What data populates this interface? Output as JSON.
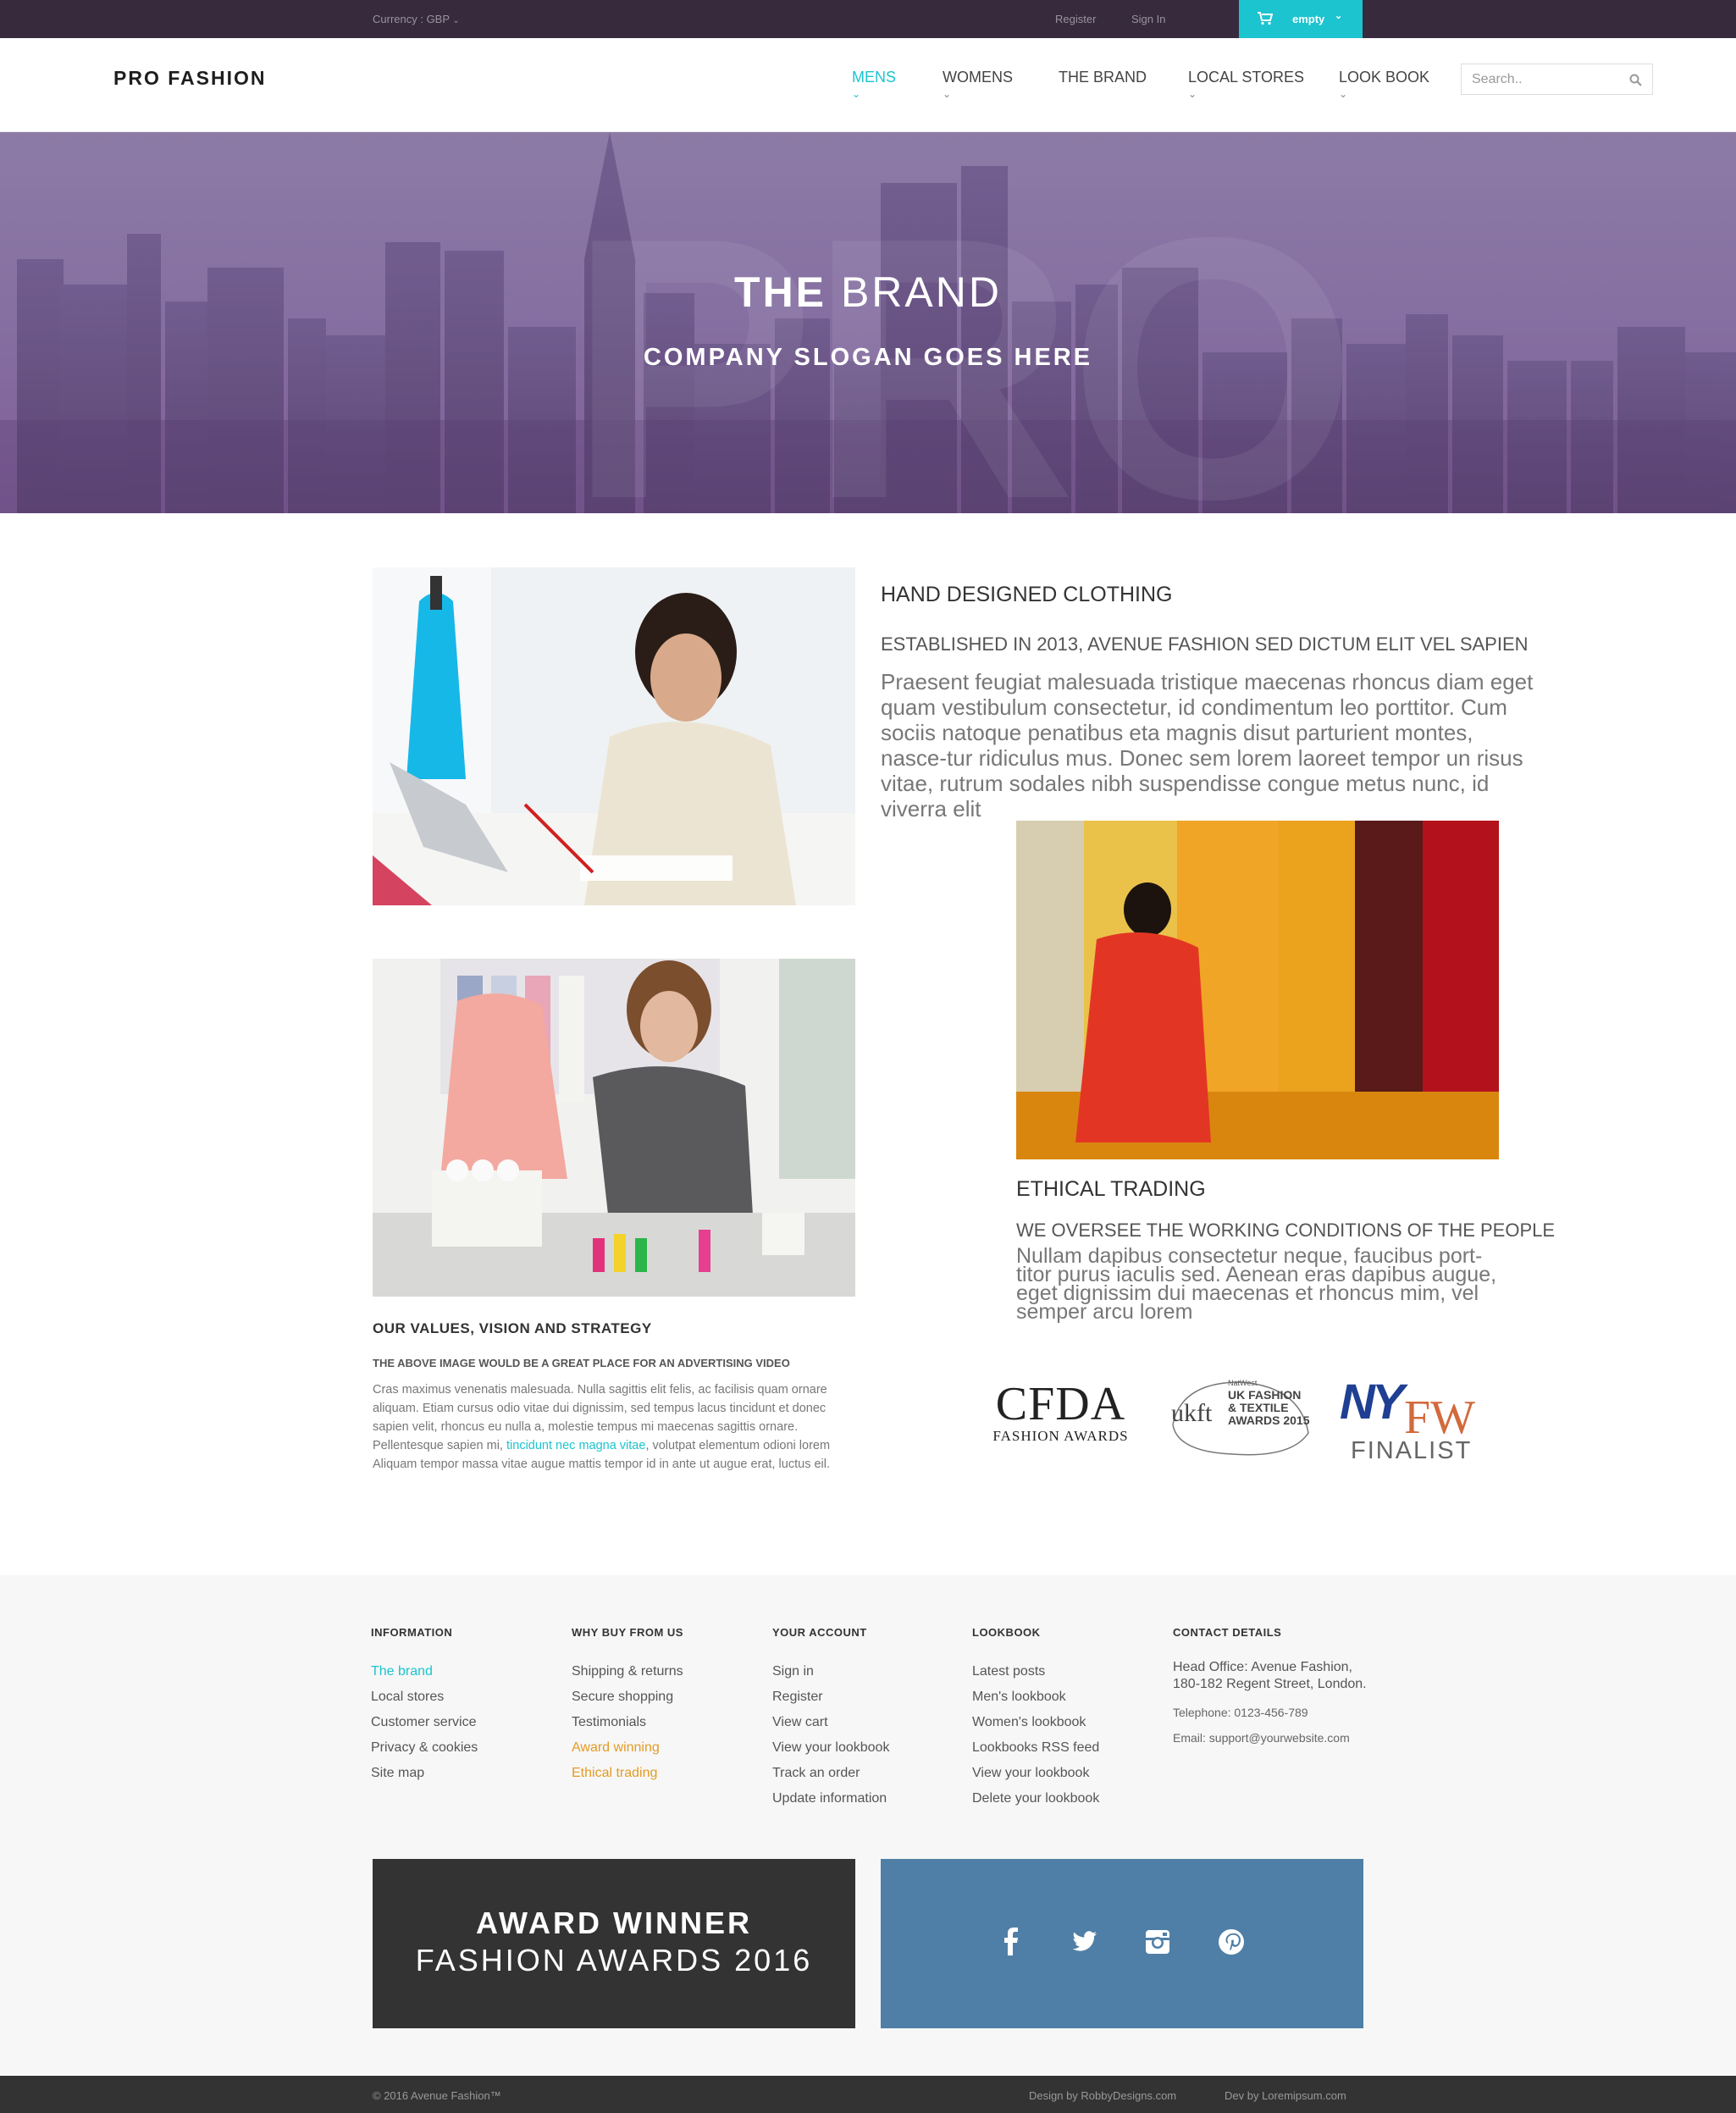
{
  "topbar": {
    "currency": "Currency : GBP",
    "register": "Register",
    "sign_in": "Sign In",
    "cart_label": "empty"
  },
  "header": {
    "logo": "PRO FASHION",
    "nav": [
      {
        "label": "MENS",
        "active": true
      },
      {
        "label": "WOMENS"
      },
      {
        "label": "THE BRAND"
      },
      {
        "label": "LOCAL STORES"
      },
      {
        "label": "LOOK BOOK"
      }
    ],
    "search_placeholder": "Search.."
  },
  "hero": {
    "title_bold": "THE",
    "title_light": "BRAND",
    "slogan": "COMPANY SLOGAN GOES HERE",
    "watermark": "PRO"
  },
  "intro": {
    "heading": "HAND DESIGNED CLOTHING",
    "subheading": "ESTABLISHED IN 2013, AVENUE FASHION SED DICTUM ELIT VEL SAPIEN",
    "body": "Praesent feugiat malesuada tristique maecenas rhoncus diam eget quam vestibulum consectetur, id condimentum leo porttitor. Cum sociis natoque penatibus eta magnis disut parturient montes, nasce-tur ridiculus mus. Donec sem lorem laoreet tempor un risus vitae, rutrum sodales nibh suspendisse congue metus nunc, id viverra elit"
  },
  "values": {
    "heading": "OUR VALUES, VISION AND STRATEGY",
    "subheading": "THE ABOVE IMAGE WOULD BE A GREAT PLACE FOR AN ADVERTISING VIDEO",
    "body_start": "Cras maximus venenatis malesuada. Nulla sagittis elit felis, ac facilisis quam ornare aliquam. Etiam cursus odio vitae dui dignissim, sed tempus lacus tincidunt et donec sapien velit, rhoncus eu nulla a, molestie tempus mi maecenas sagittis ornare. Pellentesque sapien mi, ",
    "link": "tincidunt nec magna vitae",
    "body_end": ", volutpat elementum odioni lorem Aliquam tempor massa vitae augue mattis tempor id in ante ut augue erat, luctus eil."
  },
  "ethical": {
    "heading": "ETHICAL TRADING",
    "subheading": "WE OVERSEE THE WORKING CONDITIONS OF THE PEOPLE",
    "body": "Nullam dapibus consectetur neque, faucibus port-titor purus iaculis sed. Aenean eras dapibus augue, eget dignissim dui maecenas et rhoncus mim, vel semper arcu lorem"
  },
  "awards": {
    "cfda_logo": "CFDA",
    "cfda_sub": "FASHION AWARDS",
    "ukft_small": "NatWest",
    "ukft_logo": "ukft",
    "ukft_title": "UK FASHION & TEXTILE AWARDS 2015",
    "nyfw_ny": "NY",
    "nyfw_fw": "FW",
    "nyfw_sub": "FINALIST"
  },
  "footer": {
    "columns": [
      {
        "title": "INFORMATION",
        "links": [
          {
            "label": "The brand",
            "style": "teal"
          },
          {
            "label": "Local stores"
          },
          {
            "label": "Customer service"
          },
          {
            "label": "Privacy & cookies"
          },
          {
            "label": "Site map"
          }
        ]
      },
      {
        "title": "WHY BUY FROM US",
        "links": [
          {
            "label": "Shipping & returns"
          },
          {
            "label": "Secure shopping"
          },
          {
            "label": "Testimonials"
          },
          {
            "label": "Award winning",
            "style": "orange"
          },
          {
            "label": "Ethical trading",
            "style": "orange"
          }
        ]
      },
      {
        "title": "YOUR ACCOUNT",
        "links": [
          {
            "label": "Sign in"
          },
          {
            "label": "Register"
          },
          {
            "label": "View cart"
          },
          {
            "label": "View your lookbook"
          },
          {
            "label": "Track an order"
          },
          {
            "label": "Update information"
          }
        ]
      },
      {
        "title": "LOOKBOOK",
        "links": [
          {
            "label": "Latest posts"
          },
          {
            "label": "Men's lookbook"
          },
          {
            "label": "Women's lookbook"
          },
          {
            "label": "Lookbooks RSS feed"
          },
          {
            "label": "View your lookbook"
          },
          {
            "label": "Delete your lookbook"
          }
        ]
      }
    ],
    "contact": {
      "title": "CONTACT DETAILS",
      "address_line1": "Head Office: Avenue Fashion,",
      "address_line2": "180-182 Regent Street, London.",
      "telephone": "Telephone: 0123-456-789",
      "email": "Email: support@yourwebsite.com"
    },
    "award_line1": "AWARD WINNER",
    "award_line2": "FASHION AWARDS 2016",
    "social_icons": [
      "facebook-icon",
      "twitter-icon",
      "instagram-icon",
      "pinterest-icon"
    ]
  },
  "bottom": {
    "copyright": "© 2016 Avenue Fashion™",
    "design_credit": "Design by RobbyDesigns.com",
    "dev_credit": "Dev by Loremipsum.com"
  },
  "colors": {
    "accent": "#1cc4cf",
    "topbar": "#362a3c",
    "award_box": "#333333",
    "social_box": "#4f7fa6",
    "orange_link": "#e39b23"
  }
}
